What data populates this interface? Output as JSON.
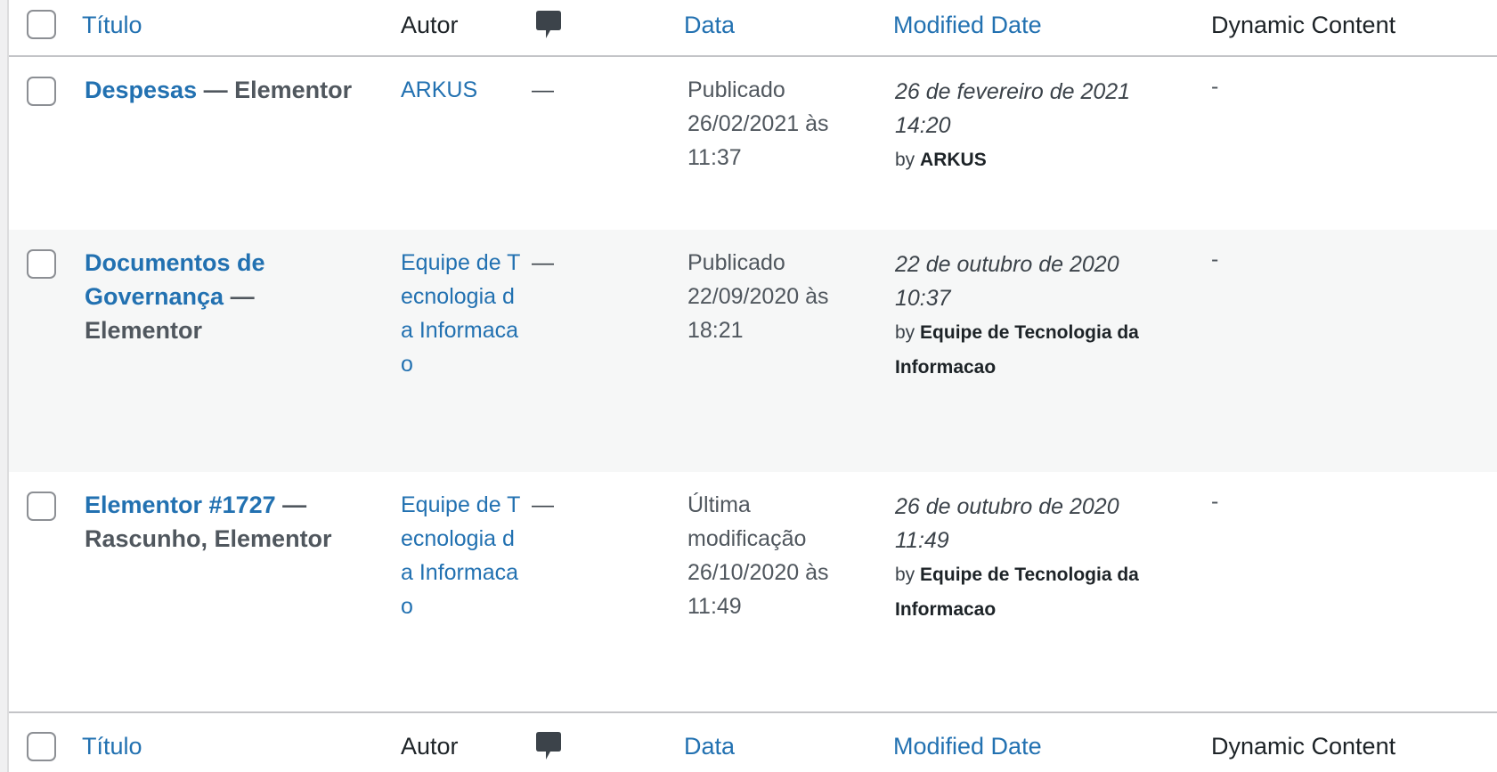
{
  "columns": {
    "title": "Título",
    "author": "Autor",
    "comments_icon": "comment-bubble-icon",
    "date": "Data",
    "modified": "Modified Date",
    "dynamic": "Dynamic Content"
  },
  "posts": [
    {
      "title": "Despesas",
      "state": "— Elementor",
      "author": "ARKUS",
      "comments": "—",
      "date_status": "Publicado",
      "date_value": "26/02/2021 às 11:37",
      "modified_date": "26 de fevereiro de 2021 14:20",
      "modified_by_prefix": "by",
      "modified_by": "ARKUS",
      "dynamic": "-"
    },
    {
      "title": "Documentos de Governança",
      "state": "— Elementor",
      "author": "Equipe de Tecnologia da Informacao",
      "comments": "—",
      "date_status": "Publicado",
      "date_value": "22/09/2020 às 18:21",
      "modified_date": "22 de outubro de 2020 10:37",
      "modified_by_prefix": "by",
      "modified_by": "Equipe de Tecnologia da Informacao",
      "dynamic": "-"
    },
    {
      "title": "Elementor #1727",
      "state": "— Rascunho, Elementor",
      "author": "Equipe de Tecnologia da Informacao",
      "comments": "—",
      "date_status": "Última modificação",
      "date_value": "26/10/2020 às 11:49",
      "modified_date": "26 de outubro de 2020 11:49",
      "modified_by_prefix": "by",
      "modified_by": "Equipe de Tecnologia da Informacao",
      "dynamic": "-"
    }
  ],
  "colors": {
    "link": "#2271b1",
    "text": "#3c434a",
    "alt_row": "#f6f7f7"
  }
}
